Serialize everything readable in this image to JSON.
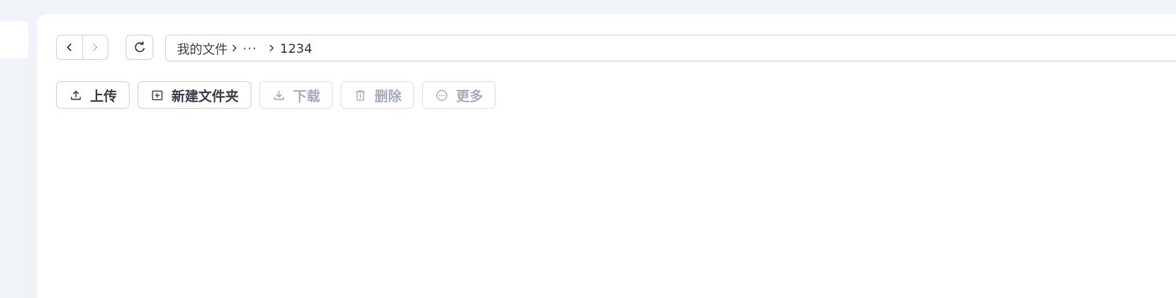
{
  "breadcrumb": {
    "root": "我的文件",
    "ellipsis": "···",
    "current": "1234"
  },
  "toolbar": {
    "upload": "上传",
    "new_folder": "新建文件夹",
    "download": "下载",
    "delete": "删除",
    "more": "更多"
  },
  "icons": {
    "back": "chevron-left-icon",
    "forward": "chevron-right-icon",
    "refresh": "refresh-icon",
    "upload": "upload-icon",
    "new_folder": "folder-plus-icon",
    "download": "download-icon",
    "delete": "trash-icon",
    "more": "more-circle-icon"
  },
  "colors": {
    "background": "#f0f3f8",
    "panel": "#ffffff",
    "border": "#cfd6df",
    "text": "#3a414d",
    "disabled_text": "#a5adbb"
  }
}
